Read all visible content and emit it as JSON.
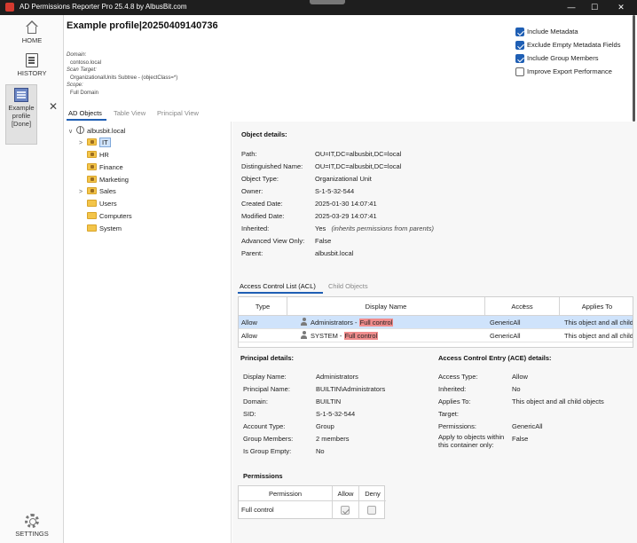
{
  "window": {
    "title": "AD Permissions Reporter Pro 25.4.8 by AlbusBit.com",
    "controls": {
      "minimize": "—",
      "maximize": "☐",
      "close": "✕"
    }
  },
  "nav": {
    "home": "HOME",
    "history": "HISTORY",
    "profile": {
      "line1": "Example",
      "line2": "profile",
      "line3": "[Done]"
    },
    "profile_close": "✕",
    "settings": "SETTINGS"
  },
  "profile": {
    "title": "Example profile|20250409140736",
    "meta": [
      {
        "key": "Domain:",
        "value": "contoso.local"
      },
      {
        "key": "Scan Target:",
        "value": "OrganizationalUnits Subtree - (objectClass=*)"
      },
      {
        "key": "Scope:",
        "value": "Full Domain"
      }
    ]
  },
  "options": [
    {
      "label": "Include Metadata",
      "checked": true
    },
    {
      "label": "Exclude Empty Metadata Fields",
      "checked": true
    },
    {
      "label": "Include Group Members",
      "checked": true
    },
    {
      "label": "Improve Export Performance",
      "checked": false
    }
  ],
  "view_tabs": [
    "AD Objects",
    "Table View",
    "Principal View"
  ],
  "tree": {
    "root": "albusbit.local",
    "root_chevron": "∨",
    "collapsed_chevron": ">",
    "children": [
      "IT",
      "HR",
      "Finance",
      "Marketing",
      "Sales",
      "Users",
      "Computers",
      "System"
    ]
  },
  "object_details": {
    "heading": "Object details:",
    "rows": [
      {
        "key": "Path:",
        "value": "OU=IT,DC=albusbit,DC=local"
      },
      {
        "key": "Distinguished Name:",
        "value": "OU=IT,DC=albusbit,DC=local"
      },
      {
        "key": "Object Type:",
        "value": "Organizational Unit"
      },
      {
        "key": "Owner:",
        "value": "S-1-5-32-544"
      },
      {
        "key": "Created Date:",
        "value": "2025-01-30 14:07:41"
      },
      {
        "key": "Modified Date:",
        "value": "2025-03-29 14:07:41"
      },
      {
        "key": "Inherited:",
        "value": "Yes",
        "note": "(inherits permissions from parents)"
      },
      {
        "key": "Advanced View Only:",
        "value": "False"
      },
      {
        "key": "Parent:",
        "value": "albusbit.local"
      }
    ]
  },
  "acl_tabs": [
    "Access Control List (ACL)",
    "Child Objects"
  ],
  "acl_table": {
    "columns": [
      "Type",
      "Display Name",
      "Access",
      "Applies To"
    ],
    "sort_arrow": "↑",
    "rows": [
      {
        "type": "Allow",
        "name": "Administrators",
        "sep": " - ",
        "perm": "Full control",
        "access": "GenericAll",
        "applies": "This object and all child objects"
      },
      {
        "type": "Allow",
        "name": "SYSTEM",
        "sep": " - ",
        "perm": "Full control",
        "access": "GenericAll",
        "applies": "This object and all child objects"
      }
    ]
  },
  "principal_details": {
    "heading": "Principal details:",
    "rows": [
      {
        "key": "Display Name:",
        "value": "Administrators"
      },
      {
        "key": "Principal Name:",
        "value": "BUILTIN\\Administrators"
      },
      {
        "key": "Domain:",
        "value": "BUILTIN"
      },
      {
        "key": "SID:",
        "value": "S-1-5-32-544"
      },
      {
        "key": "Account Type:",
        "value": "Group"
      },
      {
        "key": "Group Members:",
        "value": "2 members"
      },
      {
        "key": "Is Group Empty:",
        "value": "No"
      }
    ]
  },
  "ace_details": {
    "heading": "Access Control Entry (ACE) details:",
    "rows": [
      {
        "key": "Access Type:",
        "value": "Allow"
      },
      {
        "key": "Inherited:",
        "value": "No"
      },
      {
        "key": "Applies To:",
        "value": "This object and all child objects"
      },
      {
        "key": "Target:",
        "value": ""
      },
      {
        "key": "Permissions:",
        "value": "GenericAll"
      },
      {
        "key": "Apply to objects within this container only:",
        "value": "False"
      }
    ]
  },
  "permissions": {
    "heading": "Permissions",
    "columns": [
      "Permission",
      "Allow",
      "Deny"
    ],
    "rows": [
      {
        "name": "Full control",
        "allow": true,
        "deny": false
      }
    ]
  }
}
